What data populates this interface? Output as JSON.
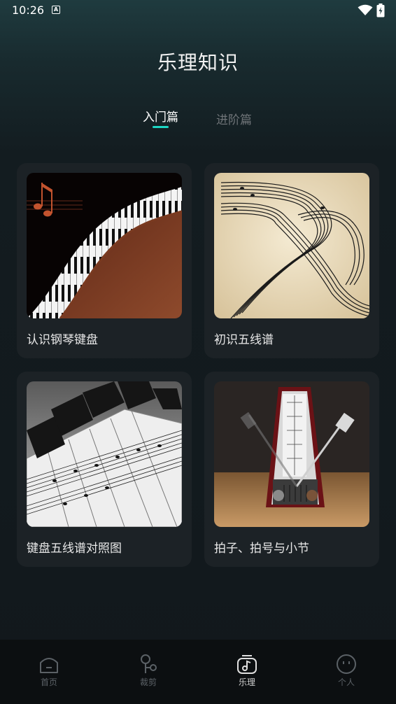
{
  "status_bar": {
    "time": "10:26",
    "notification_badge": "A"
  },
  "page": {
    "title": "乐理知识"
  },
  "tabs": [
    {
      "label": "入门篇",
      "active": true
    },
    {
      "label": "进阶篇",
      "active": false
    }
  ],
  "accent_color": "#1dd6c4",
  "cards": [
    {
      "label": "认识钢琴键盘",
      "icon": "piano-keyboard-image"
    },
    {
      "label": "初识五线谱",
      "icon": "staff-notation-image"
    },
    {
      "label": "键盘五线谱对照图",
      "icon": "keyboard-staff-chart-image"
    },
    {
      "label": "拍子、拍号与小节",
      "icon": "metronome-image"
    }
  ],
  "bottom_nav": [
    {
      "label": "首页",
      "icon": "home-icon",
      "active": false
    },
    {
      "label": "裁剪",
      "icon": "scissors-icon",
      "active": false
    },
    {
      "label": "乐理",
      "icon": "music-note-icon",
      "active": true
    },
    {
      "label": "个人",
      "icon": "smiley-face-icon",
      "active": false
    }
  ]
}
